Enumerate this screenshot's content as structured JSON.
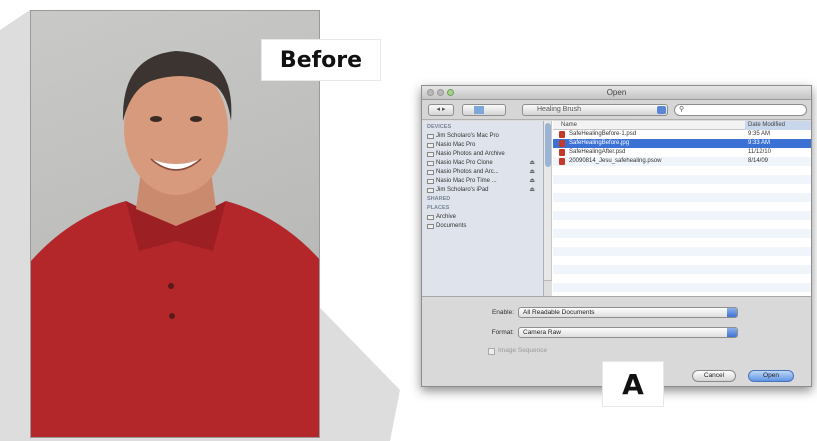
{
  "labels": {
    "before": "Before",
    "a": "A"
  },
  "dialog": {
    "title": "Open",
    "folder": "Healing Brush",
    "sidebar": {
      "devices_header": "DEVICES",
      "devices": [
        {
          "label": "Jim Scholaro's Mac Pro",
          "eject": false
        },
        {
          "label": "Nasio Mac Pro",
          "eject": false
        },
        {
          "label": "Nasio Photos and Archive",
          "eject": false
        },
        {
          "label": "Nasio Mac Pro Clone",
          "eject": true
        },
        {
          "label": "Nasio Photos and Arc...",
          "eject": true
        },
        {
          "label": "Nasio Mac Pro Time ...",
          "eject": true
        },
        {
          "label": "Jim Scholaro's iPad",
          "eject": true
        }
      ],
      "shared_header": "SHARED",
      "places_header": "PLACES",
      "places": [
        {
          "label": "Archive"
        },
        {
          "label": "Documents"
        }
      ]
    },
    "columns": {
      "name": "Name",
      "date": "Date Modified"
    },
    "files": [
      {
        "name": "SafeHealingBefore-1.psd",
        "date": "9:35 AM",
        "selected": false,
        "icon": "psd-file-icon"
      },
      {
        "name": "SafeHealingBefore.jpg",
        "date": "9:33 AM",
        "selected": true,
        "icon": "jpg-file-icon"
      },
      {
        "name": "SafeHealingAfter.psd",
        "date": "11/12/10",
        "selected": false,
        "icon": "psd-file-icon"
      },
      {
        "name": "20090814_Jesu_safehealing.psow",
        "date": "8/14/09",
        "selected": false,
        "icon": "doc-file-icon"
      }
    ],
    "enable_label": "Enable:",
    "enable_value": "All Readable Documents",
    "format_label": "Format:",
    "format_value": "Camera Raw",
    "image_sequence_label": "Image Sequence",
    "cancel_label": "Cancel",
    "open_label": "Open"
  }
}
